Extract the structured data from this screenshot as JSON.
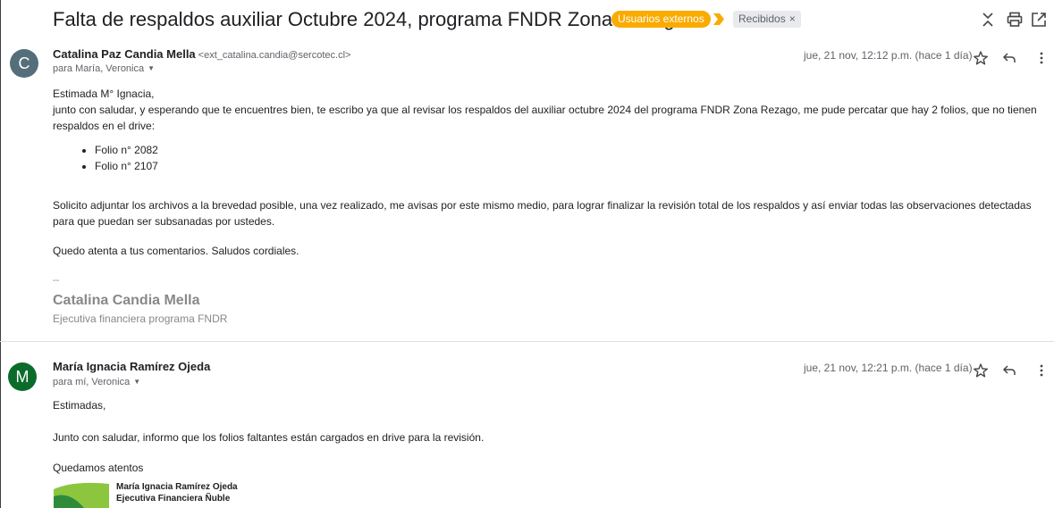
{
  "thread": {
    "subject": "Falta de respaldos auxiliar Octubre 2024, programa FNDR Zona Rezago",
    "labels": {
      "external": "Usuarios externos",
      "inbox": "Recibidos",
      "inbox_remove": "×"
    }
  },
  "colors": {
    "avatar1": "#546e7a",
    "avatar2": "#0b6b2b",
    "external_label": "#f9ab00",
    "logo_green": "#8cc63f",
    "logo_dark_green": "#2e8b3a"
  },
  "messages": [
    {
      "avatar_letter": "C",
      "sender_name": "Catalina Paz Candia Mella",
      "sender_email": "<ext_catalina.candia@sercotec.cl>",
      "recipients": "para María, Veronica",
      "date": "jue, 21 nov, 12:12 p.m. (hace 1 día)",
      "greeting": "Estimada M° Ignacia,",
      "para1": "junto con saludar, y esperando que te encuentres bien, te escribo ya que al revisar los respaldos del auxiliar octubre 2024 del programa FNDR Zona Rezago, me pude percatar que hay 2 folios, que no tienen respaldos en el drive:",
      "bullets": [
        "Folio n° 2082",
        "Folio n° 2107"
      ],
      "para2": "Solicito adjuntar los archivos a la brevedad posible, una vez realizado, me avisas por este mismo medio, para lograr finalizar la revisión total de los respaldos y así enviar todas las observaciones detectadas para que puedan ser subsanadas por ustedes.",
      "para3": "Quedo atenta a tus comentarios. Saludos cordiales.",
      "sig_dash": "--",
      "sig_name": "Catalina Candia Mella",
      "sig_title": "Ejecutiva financiera programa FNDR"
    },
    {
      "avatar_letter": "M",
      "sender_name": "María Ignacia Ramírez Ojeda",
      "recipients": "para mí, Veronica",
      "date": "jue, 21 nov, 12:21 p.m. (hace 1 día)",
      "greeting": "Estimadas,",
      "para1": "Junto con saludar, informo que los folios faltantes están cargados en drive para la revisión.",
      "para2": "Quedamos atentos",
      "sig_name": "María Ignacia Ramírez Ojeda",
      "sig_title": "Ejecutiva Financiera Ñuble"
    }
  ]
}
